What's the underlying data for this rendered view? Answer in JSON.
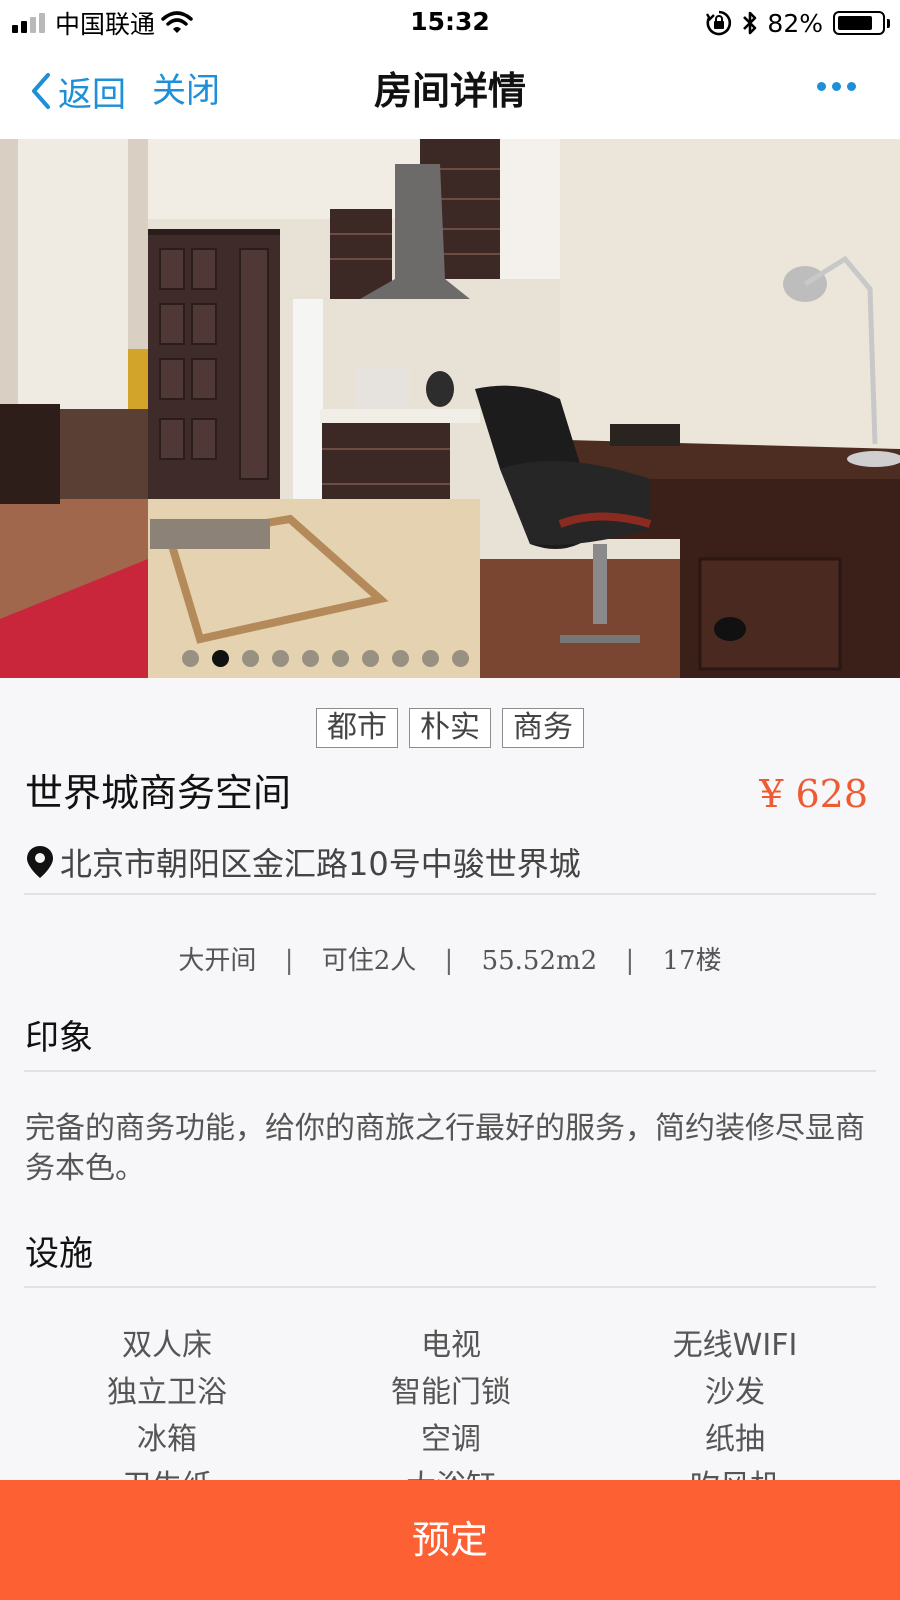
{
  "status_bar": {
    "carrier": "中国联通",
    "time": "15:32",
    "battery": "82%",
    "battery_level": 0.82
  },
  "nav": {
    "back_label": "返回",
    "close_label": "关闭",
    "title": "房间详情"
  },
  "gallery": {
    "total": 10,
    "active": 1
  },
  "tags": [
    "都市",
    "朴实",
    "商务"
  ],
  "room": {
    "name": "世界城商务空间",
    "price": "¥ 628",
    "address": "北京市朝阳区金汇路10号中骏世界城"
  },
  "room_info": {
    "layout": "大开间",
    "capacity": "可住2人",
    "area": "55.52m2",
    "floor": "17楼",
    "separator": "|"
  },
  "impression": {
    "title": "印象",
    "text": "完备的商务功能，给你的商旅之行最好的服务，简约装修尽显商务本色。"
  },
  "facilities": {
    "title": "设施",
    "items": [
      "双人床",
      "电视",
      "无线WIFI",
      "独立卫浴",
      "智能门锁",
      "沙发",
      "冰箱",
      "空调",
      "纸抽",
      "卫生纸",
      "大浴缸",
      "吹风机"
    ]
  },
  "book_button": "预定",
  "colors": {
    "accent_blue": "#1e8fd8",
    "price_orange": "#ee5b32",
    "book_button_bg": "#fd6033"
  }
}
